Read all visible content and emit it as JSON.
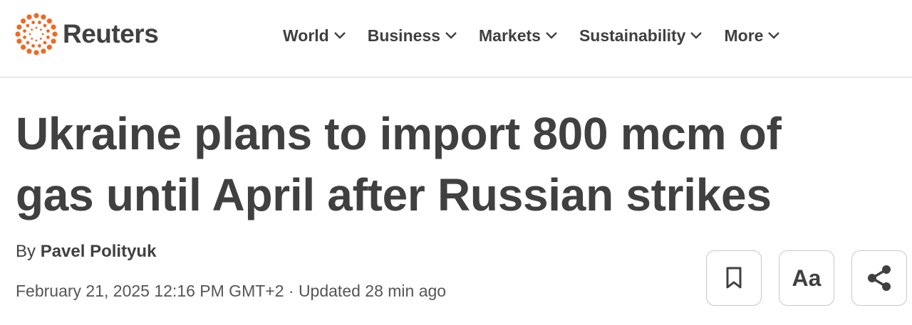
{
  "header": {
    "logo_text": "Reuters",
    "logo_icon": "reuters-dots-icon",
    "brand_color": "#f26722",
    "nav": [
      {
        "label": "World",
        "icon": "chevron-down-icon"
      },
      {
        "label": "Business",
        "icon": "chevron-down-icon"
      },
      {
        "label": "Markets",
        "icon": "chevron-down-icon"
      },
      {
        "label": "Sustainability",
        "icon": "chevron-down-icon"
      },
      {
        "label": "More",
        "icon": "chevron-down-icon"
      }
    ]
  },
  "article": {
    "headline_line1": "Ukraine plans to import 800 mcm of",
    "headline_line2": "gas until April after Russian strikes",
    "byline_prefix": "By",
    "author": "Pavel Polityuk",
    "dateline": "February 21, 2025 12:16 PM GMT+2 · Updated 28 min ago"
  },
  "tools": {
    "bookmark_icon": "bookmark-icon",
    "text_size_label": "Aa",
    "share_icon": "share-icon"
  }
}
